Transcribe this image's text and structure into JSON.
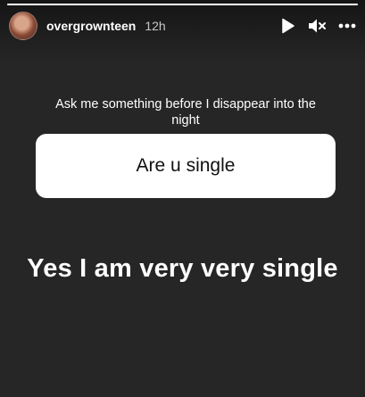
{
  "story": {
    "username": "overgrownteen",
    "time": "12h",
    "progress": 1.0,
    "controls": {
      "play_icon": "play-icon",
      "mute_icon": "muted-speaker-icon",
      "more_icon": "more-horizontal-icon"
    }
  },
  "question_sticker": {
    "prompt": "Ask me something before I disappear into the night",
    "answer": "Are u single"
  },
  "caption": "Yes I am very very single",
  "colors": {
    "background": "#262626",
    "sticker_card": "#ffffff",
    "text": "#ffffff"
  }
}
